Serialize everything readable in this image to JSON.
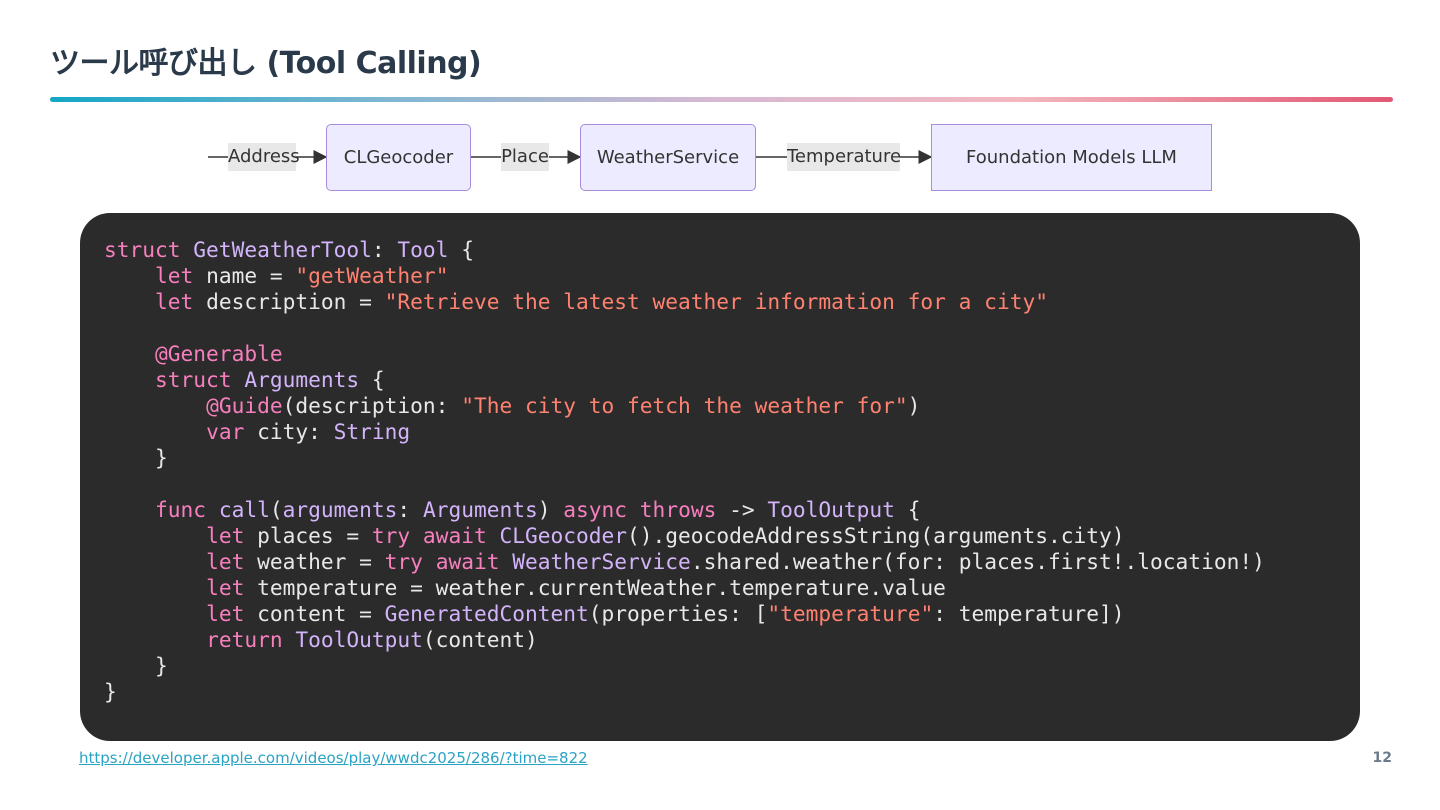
{
  "slide": {
    "title": "ツール呼び出し (Tool Calling)",
    "page_number": "12",
    "source_link": "https://developer.apple.com/videos/play/wwdc2025/286/?time=822"
  },
  "flow": {
    "edge_labels": [
      "Address",
      "Place",
      "Temperature"
    ],
    "nodes": [
      "CLGeocoder",
      "WeatherService",
      "Foundation Models LLM"
    ]
  },
  "code": {
    "lines": [
      [
        [
          "kw",
          "struct "
        ],
        [
          "typ",
          "GetWeatherTool"
        ],
        [
          "id",
          ": "
        ],
        [
          "typ",
          "Tool"
        ],
        [
          "id",
          " {"
        ]
      ],
      [
        [
          "id",
          "    "
        ],
        [
          "kw",
          "let"
        ],
        [
          "id",
          " name = "
        ],
        [
          "str",
          "\"getWeather\""
        ]
      ],
      [
        [
          "id",
          "    "
        ],
        [
          "kw",
          "let"
        ],
        [
          "id",
          " description = "
        ],
        [
          "str",
          "\"Retrieve the latest weather information for a city\""
        ]
      ],
      [],
      [
        [
          "id",
          "    "
        ],
        [
          "kw",
          "@Generable"
        ]
      ],
      [
        [
          "id",
          "    "
        ],
        [
          "kw",
          "struct "
        ],
        [
          "typ",
          "Arguments"
        ],
        [
          "id",
          " {"
        ]
      ],
      [
        [
          "id",
          "        "
        ],
        [
          "kw",
          "@Guide"
        ],
        [
          "id",
          "(description: "
        ],
        [
          "str",
          "\"The city to fetch the weather for\""
        ],
        [
          "id",
          ")"
        ]
      ],
      [
        [
          "id",
          "        "
        ],
        [
          "kw",
          "var"
        ],
        [
          "id",
          " city: "
        ],
        [
          "typ",
          "String"
        ]
      ],
      [
        [
          "id",
          "    }"
        ]
      ],
      [],
      [
        [
          "id",
          "    "
        ],
        [
          "kw",
          "func "
        ],
        [
          "typ",
          "call"
        ],
        [
          "id",
          "("
        ],
        [
          "typ",
          "arguments"
        ],
        [
          "id",
          ": "
        ],
        [
          "typ",
          "Arguments"
        ],
        [
          "id",
          ") "
        ],
        [
          "kw",
          "async throws"
        ],
        [
          "id",
          " -> "
        ],
        [
          "typ",
          "ToolOutput"
        ],
        [
          "id",
          " {"
        ]
      ],
      [
        [
          "id",
          "        "
        ],
        [
          "kw",
          "let"
        ],
        [
          "id",
          " places = "
        ],
        [
          "kw",
          "try await "
        ],
        [
          "typ",
          "CLGeocoder"
        ],
        [
          "id",
          "().geocodeAddressString(arguments.city)"
        ]
      ],
      [
        [
          "id",
          "        "
        ],
        [
          "kw",
          "let"
        ],
        [
          "id",
          " weather = "
        ],
        [
          "kw",
          "try await "
        ],
        [
          "typ",
          "WeatherService"
        ],
        [
          "id",
          ".shared.weather(for: places.first!.location!)"
        ]
      ],
      [
        [
          "id",
          "        "
        ],
        [
          "kw",
          "let"
        ],
        [
          "id",
          " temperature = weather.currentWeather.temperature.value"
        ]
      ],
      [
        [
          "id",
          "        "
        ],
        [
          "kw",
          "let"
        ],
        [
          "id",
          " content = "
        ],
        [
          "typ",
          "GeneratedContent"
        ],
        [
          "id",
          "(properties: ["
        ],
        [
          "str",
          "\"temperature\""
        ],
        [
          "id",
          ": temperature])"
        ]
      ],
      [
        [
          "id",
          "        "
        ],
        [
          "kw",
          "return "
        ],
        [
          "typ",
          "ToolOutput"
        ],
        [
          "id",
          "(content)"
        ]
      ],
      [
        [
          "id",
          "    }"
        ]
      ],
      [
        [
          "id",
          "}"
        ]
      ]
    ]
  }
}
